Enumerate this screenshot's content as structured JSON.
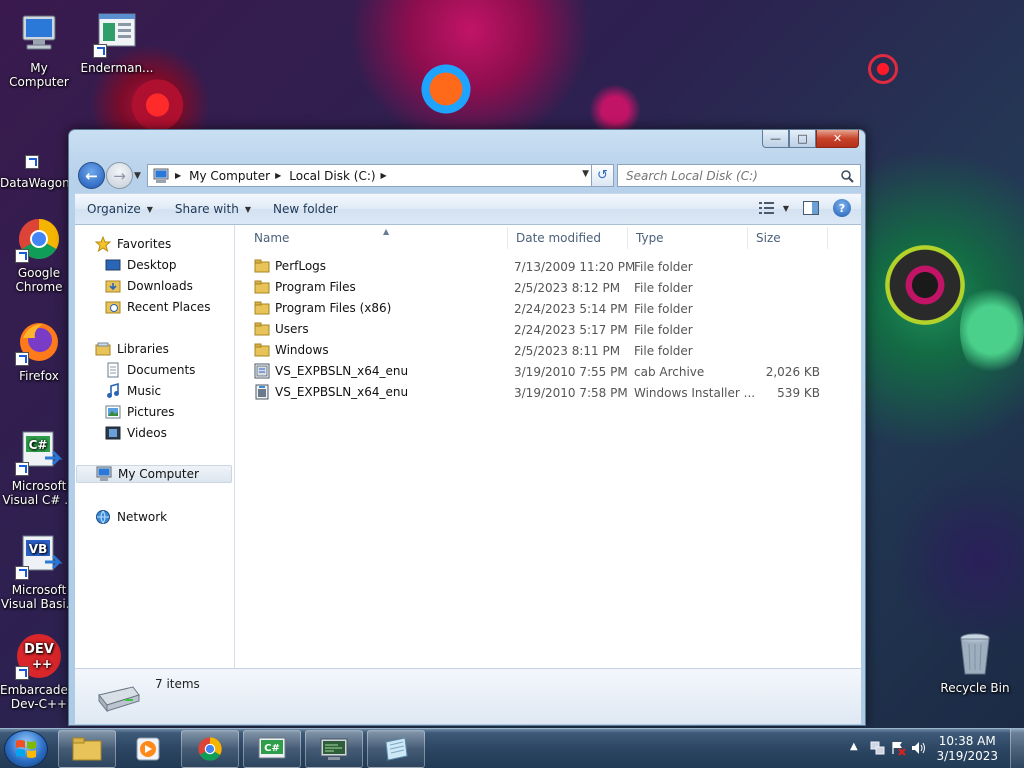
{
  "desktop": {
    "icons": {
      "my_computer": "My Computer",
      "enderman": "Enderman...",
      "datawagon": "DataWagon...",
      "chrome": "Google Chrome",
      "firefox": "Firefox",
      "csharp": "Microsoft Visual C# ...",
      "vb": "Microsoft Visual Basi...",
      "devcpp": "Embarcadero Dev-C++",
      "recycle": "Recycle Bin"
    }
  },
  "explorer": {
    "breadcrumb": [
      "My Computer",
      "Local Disk (C:)"
    ],
    "search_placeholder": "Search Local Disk (C:)",
    "toolbar": {
      "organize": "Organize",
      "share_with": "Share with",
      "new_folder": "New folder"
    },
    "nav": {
      "favorites": "Favorites",
      "desktop": "Desktop",
      "downloads": "Downloads",
      "recent_places": "Recent Places",
      "libraries": "Libraries",
      "documents": "Documents",
      "music": "Music",
      "pictures": "Pictures",
      "videos": "Videos",
      "my_computer": "My Computer",
      "network": "Network"
    },
    "columns": {
      "name": "Name",
      "date_modified": "Date modified",
      "type": "Type",
      "size": "Size"
    },
    "files": [
      {
        "name": "PerfLogs",
        "date": "7/13/2009 11:20 PM",
        "type": "File folder",
        "size": "",
        "icon": "folder-icon"
      },
      {
        "name": "Program Files",
        "date": "2/5/2023 8:12 PM",
        "type": "File folder",
        "size": "",
        "icon": "folder-icon"
      },
      {
        "name": "Program Files (x86)",
        "date": "2/24/2023 5:14 PM",
        "type": "File folder",
        "size": "",
        "icon": "folder-icon"
      },
      {
        "name": "Users",
        "date": "2/24/2023 5:17 PM",
        "type": "File folder",
        "size": "",
        "icon": "folder-icon"
      },
      {
        "name": "Windows",
        "date": "2/5/2023 8:11 PM",
        "type": "File folder",
        "size": "",
        "icon": "folder-icon"
      },
      {
        "name": "VS_EXPBSLN_x64_enu",
        "date": "3/19/2010 7:55 PM",
        "type": "cab Archive",
        "size": "2,026 KB",
        "icon": "cab-file-icon"
      },
      {
        "name": "VS_EXPBSLN_x64_enu",
        "date": "3/19/2010 7:58 PM",
        "type": "Windows Installer ...",
        "size": "539 KB",
        "icon": "msi-file-icon"
      }
    ],
    "status": {
      "item_count": "7 items"
    }
  },
  "taskbar": {
    "clock_time": "10:38 AM",
    "clock_date": "3/19/2023"
  },
  "colors": {
    "window_frame": "#b7d1ea",
    "close_button": "#c7432a",
    "folder": "#e8c35a",
    "taskbar": "#2c4663"
  }
}
